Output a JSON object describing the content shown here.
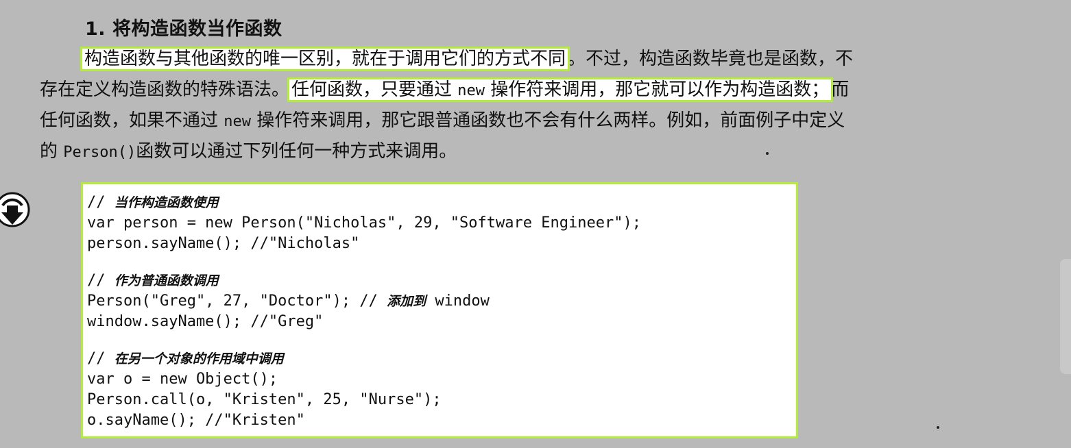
{
  "heading": "1. 将构造函数当作函数",
  "paragraph": {
    "l1_hl": "构造函数与其他函数的唯一区别，就在于调用它们的方式不同",
    "l1_rest": "。不过，构造函数毕竟也是函数，不",
    "l2_a": "存在定义构造函数的特殊语法。",
    "l2_hl_a": "任何函数，只要通过 ",
    "l2_hl_new": "new",
    "l2_hl_b": " 操作符来调用，那它就可以作为构造函数；",
    "l2_end": "而",
    "l3_a": "任何函数，如果不通过 ",
    "l3_new": "new",
    "l3_b": " 操作符来调用，那它跟普通函数也不会有什么两样。例如，前面例子中定义",
    "l4_a": "的 ",
    "l4_code": "Person()",
    "l4_b": "函数可以通过下列任何一种方式来调用。"
  },
  "code": {
    "c1_slash": "// ",
    "c1_text": "当作构造函数使用",
    "line2": "var person = new Person(\"Nicholas\", 29, \"Software Engineer\");",
    "line3": "person.sayName(); //\"Nicholas\"",
    "c2_slash": "// ",
    "c2_text": "作为普通函数调用",
    "line5_code": "Person(\"Greg\", 27, \"Doctor\"); // ",
    "line5_comment": "添加到",
    "line5_tail": " window",
    "line6": "window.sayName(); //\"Greg\"",
    "c3_slash": "// ",
    "c3_text": "在另一个对象的作用域中调用",
    "line8": "var o = new Object();",
    "line9": "Person.call(o, \"Kristen\", 25, \"Nurse\");",
    "line10": "o.sayName(); //\"Kristen\""
  },
  "icons": {
    "code_marker": "download-arrow-circle-icon"
  },
  "colors": {
    "background": "#b9b9b9",
    "highlight_border": "#b4ec3d",
    "highlight_fill": "#ffffff"
  }
}
